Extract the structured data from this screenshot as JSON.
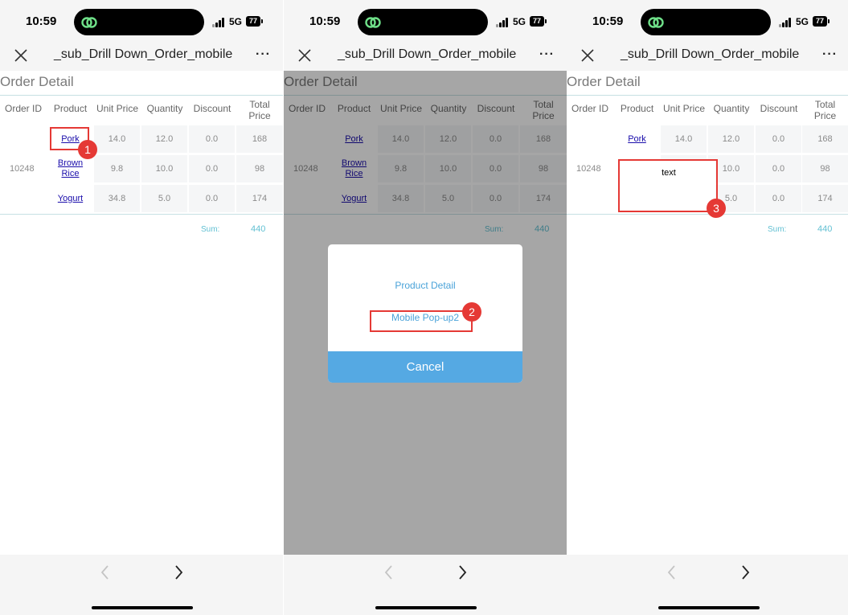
{
  "status": {
    "time": "10:59",
    "network": "5G",
    "battery": "77"
  },
  "navbar": {
    "title": "_sub_Drill Down_Order_mobile",
    "more": "···"
  },
  "section_title": "Order Detail",
  "table": {
    "headers": [
      "Order ID",
      "Product",
      "Unit Price",
      "Quantity",
      "Discount",
      "Total\nPrice"
    ],
    "order_id": "10248",
    "rows": [
      {
        "product": "Pork",
        "unit_price": "14.0",
        "quantity": "12.0",
        "discount": "0.0",
        "total": "168"
      },
      {
        "product": "Brown\nRice",
        "unit_price": "9.8",
        "quantity": "10.0",
        "discount": "0.0",
        "total": "98"
      },
      {
        "product": "Yogurt",
        "unit_price": "34.8",
        "quantity": "5.0",
        "discount": "0.0",
        "total": "174"
      }
    ],
    "sum_label": "Sum:",
    "sum_value": "440"
  },
  "action_sheet": {
    "item1": "Product Detail",
    "item2": "Mobile Pop-up2",
    "cancel": "Cancel"
  },
  "popup_text": "text",
  "badges": [
    "1",
    "2",
    "3"
  ],
  "colors": {
    "accent": "#55a9e3",
    "highlight": "#e53935",
    "link": "#1a0dab",
    "sum": "#63c1d3"
  }
}
